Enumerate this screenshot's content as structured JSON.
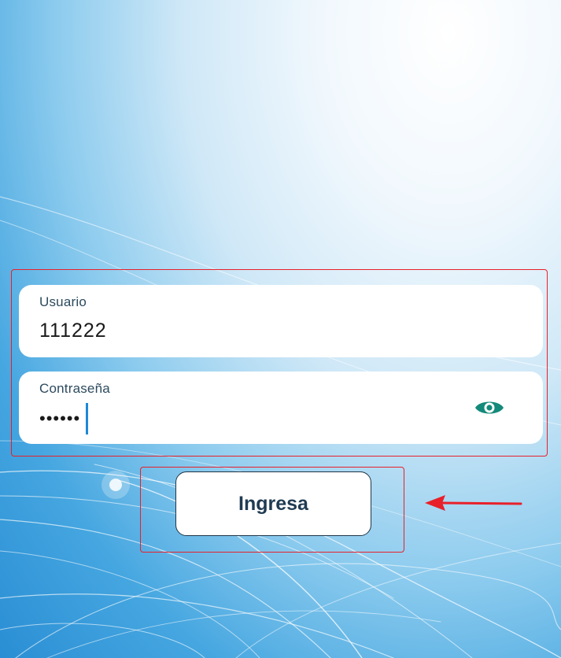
{
  "login": {
    "username": {
      "label": "Usuario",
      "value": "111222"
    },
    "password": {
      "label": "Contraseña",
      "masked_value": "••••••",
      "toggle_icon": "eye-icon"
    },
    "submit_label": "Ingresa"
  },
  "colors": {
    "accent": "#138a7a",
    "highlight": "#e8202a",
    "button_text": "#1f3b52",
    "caret": "#1e88d6"
  }
}
